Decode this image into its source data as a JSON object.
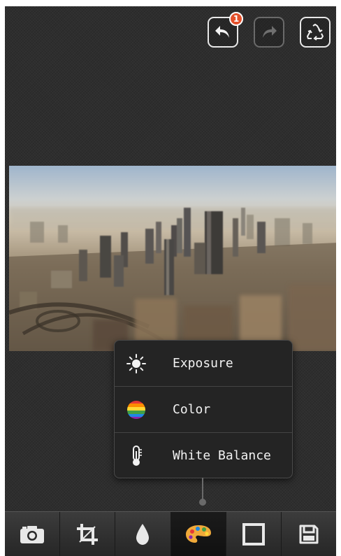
{
  "header": {
    "undo": {
      "icon": "undo-icon",
      "badge_count": "1"
    },
    "redo": {
      "icon": "redo-icon",
      "enabled": false
    },
    "reset": {
      "icon": "recycle-icon"
    }
  },
  "colors": {
    "background": "#2e2e2e",
    "accent_badge": "#e4502a",
    "menu_bg": "#242424",
    "active_tab_bg": "#141414"
  },
  "photo": {
    "subject": "aerial city view"
  },
  "popup_menu": {
    "items": [
      {
        "label": "Exposure",
        "icon": "sun-icon"
      },
      {
        "label": "Color",
        "icon": "color-balls-icon"
      },
      {
        "label": "White Balance",
        "icon": "thermometer-icon"
      }
    ]
  },
  "toolbar": {
    "tools": [
      {
        "icon": "camera-icon"
      },
      {
        "icon": "crop-icon"
      },
      {
        "icon": "droplet-icon"
      },
      {
        "icon": "palette-icon",
        "active": true
      },
      {
        "icon": "frame-icon"
      },
      {
        "icon": "save-icon"
      }
    ]
  }
}
